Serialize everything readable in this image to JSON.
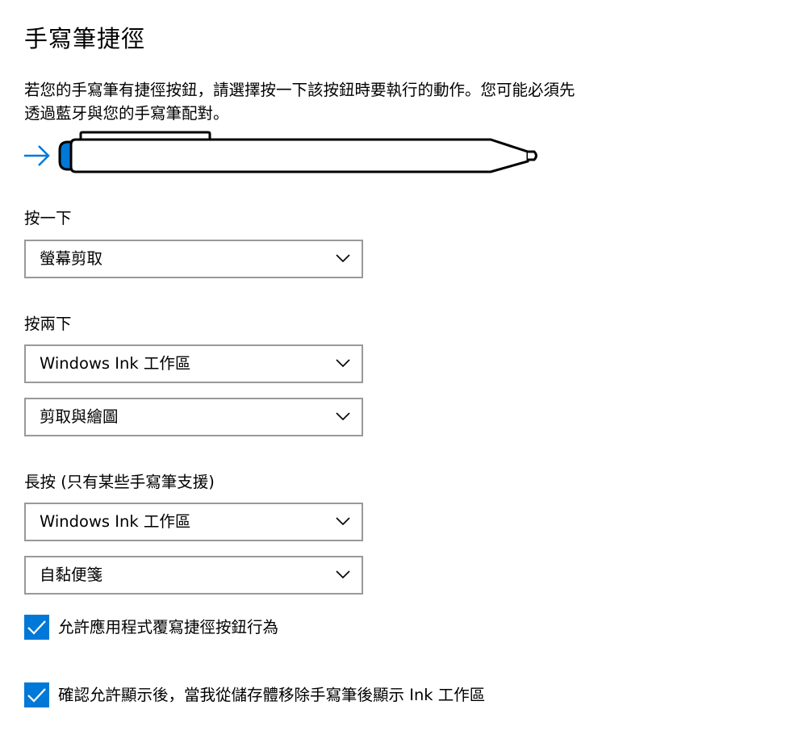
{
  "page": {
    "title": "手寫筆捷徑",
    "description": "若您的手寫筆有捷徑按鈕，請選擇按一下該按鈕時要執行的動作。您可能必須先透過藍牙與您的手寫筆配對。"
  },
  "illustration": {
    "arrow_icon": "right-arrow-icon",
    "pen_icon": "pen-icon",
    "accent_color": "#0078d7"
  },
  "single_click": {
    "label": "按一下",
    "dropdown_value": "螢幕剪取"
  },
  "double_click": {
    "label": "按兩下",
    "dropdown_1_value": "Windows Ink 工作區",
    "dropdown_2_value": "剪取與繪圖"
  },
  "press_hold": {
    "label": "長按 (只有某些手寫筆支援)",
    "dropdown_1_value": "Windows Ink 工作區",
    "dropdown_2_value": "自黏便箋"
  },
  "checkboxes": [
    {
      "label": "允許應用程式覆寫捷徑按鈕行為",
      "checked": true
    },
    {
      "label": "確認允許顯示後，當我從儲存體移除手寫筆後顯示 Ink 工作區",
      "checked": true
    }
  ],
  "colors": {
    "accent": "#0078d7",
    "dropdown_border": "#999999",
    "text": "#000000"
  }
}
